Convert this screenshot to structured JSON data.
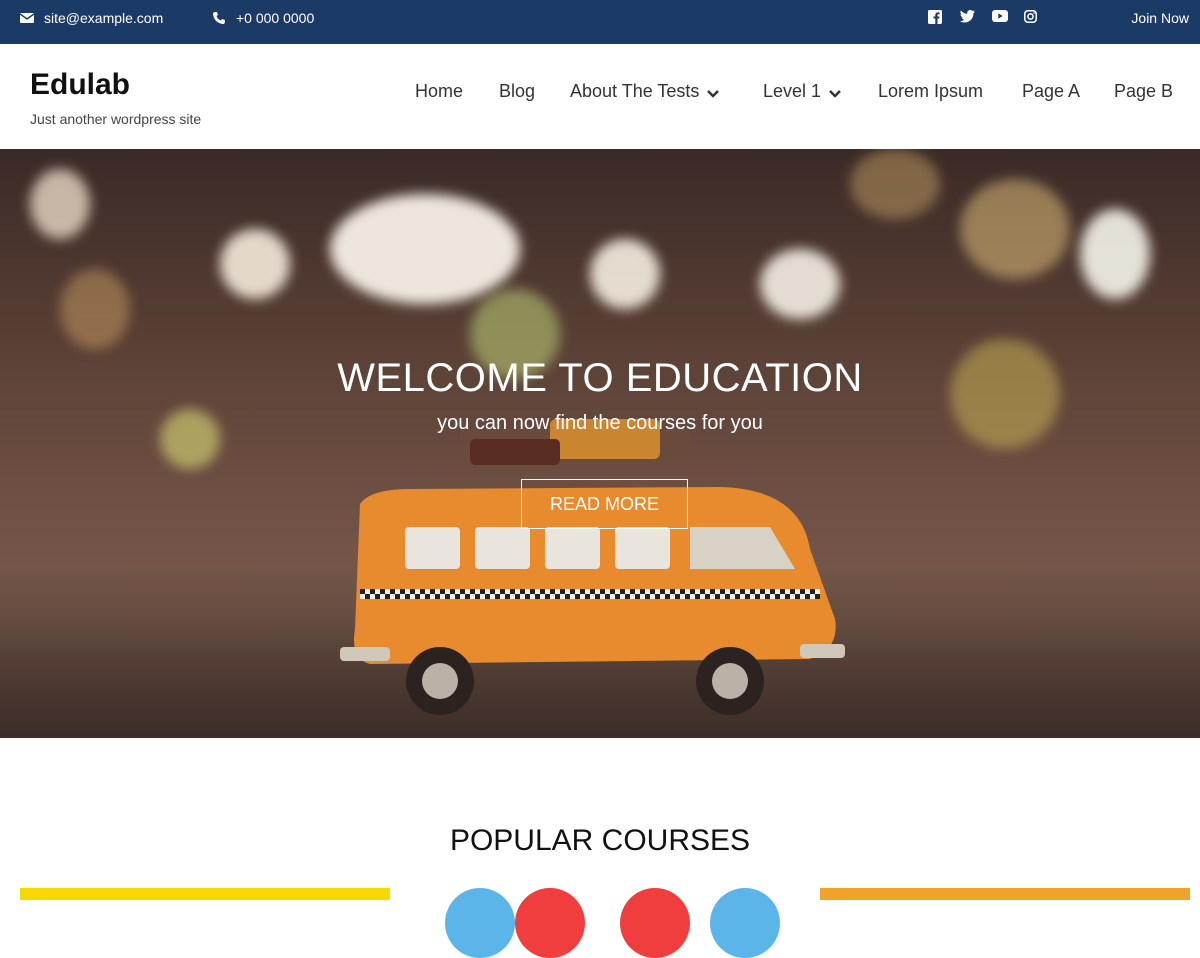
{
  "topbar": {
    "email": "site@example.com",
    "phone": "+0 000 0000",
    "join": "Join Now",
    "social_icons": [
      "facebook-icon",
      "twitter-icon",
      "youtube-icon",
      "instagram-icon"
    ],
    "background": "#1c3a66"
  },
  "header": {
    "site_title": "Edulab",
    "tagline": "Just another wordpress site"
  },
  "nav": {
    "items": [
      {
        "label": "Home"
      },
      {
        "label": "Blog"
      },
      {
        "label": "About The Tests"
      },
      {
        "label": "Level 1"
      },
      {
        "label": "Lorem Ipsum"
      },
      {
        "label": "Page A"
      },
      {
        "label": "Page B"
      }
    ]
  },
  "hero": {
    "title": "WELCOME TO EDUCATION",
    "subtitle": "you can now find the courses for you",
    "button": "READ MORE"
  },
  "popular": {
    "title": "POPULAR COURSES",
    "colors": [
      "#f7d900",
      "#5bb5e8",
      "#f03e3e",
      "#f0a32a"
    ]
  }
}
